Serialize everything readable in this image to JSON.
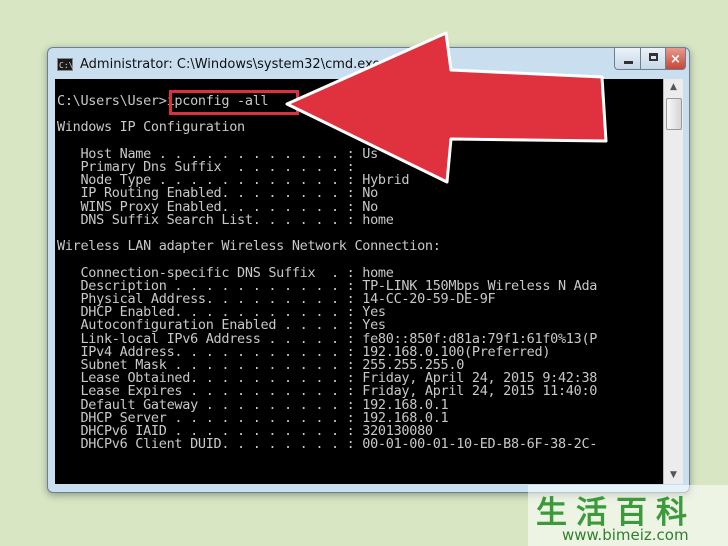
{
  "window": {
    "title": "Administrator: C:\\Windows\\system32\\cmd.exe",
    "icon": "cmd-icon",
    "buttons": {
      "minimize": "minimize-icon",
      "maximize": "maximize-icon",
      "close": "×"
    }
  },
  "console": {
    "lines": [
      "C:\\Users\\User>ipconfig -all",
      "",
      "Windows IP Configuration",
      "",
      "   Host Name . . . . . . . . . . . . : Us    C",
      "   Primary Dns Suffix  . . . . . . . :",
      "   Node Type . . . . . . . . . . . . : Hybrid",
      "   IP Routing Enabled. . . . . . . . : No",
      "   WINS Proxy Enabled. . . . . . . . : No",
      "   DNS Suffix Search List. . . . . . : home",
      "",
      "Wireless LAN adapter Wireless Network Connection:",
      "",
      "   Connection-specific DNS Suffix  . : home",
      "   Description . . . . . . . . . . . : TP-LINK 150Mbps Wireless N Ada",
      "   Physical Address. . . . . . . . . : 14-CC-20-59-DE-9F",
      "   DHCP Enabled. . . . . . . . . . . : Yes",
      "   Autoconfiguration Enabled . . . . : Yes",
      "   Link-local IPv6 Address . . . . . : fe80::850f:d81a:79f1:61f0%13(P",
      "   IPv4 Address. . . . . . . . . . . : 192.168.0.100(Preferred)",
      "   Subnet Mask . . . . . . . . . . . : 255.255.255.0",
      "   Lease Obtained. . . . . . . . . . : Friday, April 24, 2015 9:42:38",
      "   Lease Expires . . . . . . . . . . : Friday, April 24, 2015 11:40:0",
      "   Default Gateway . . . . . . . . . : 192.168.0.1",
      "   DHCP Server . . . . . . . . . . . : 192.168.0.1",
      "   DHCPv6 IAID . . . . . . . . . . . : 320130080",
      "   DHCPv6 Client DUID. . . . . . . . : 00-01-00-01-10-ED-B8-6F-38-2C-"
    ],
    "text_color": "#c8c8c8",
    "background": "#000000"
  },
  "scrollbar": {
    "up": "▲",
    "down": "▼"
  },
  "annotation": {
    "highlight_color": "#d9313d",
    "arrow_color": "#e0313f"
  },
  "watermark": {
    "chars": "生活百科",
    "url": "www.bimeiz.com"
  }
}
